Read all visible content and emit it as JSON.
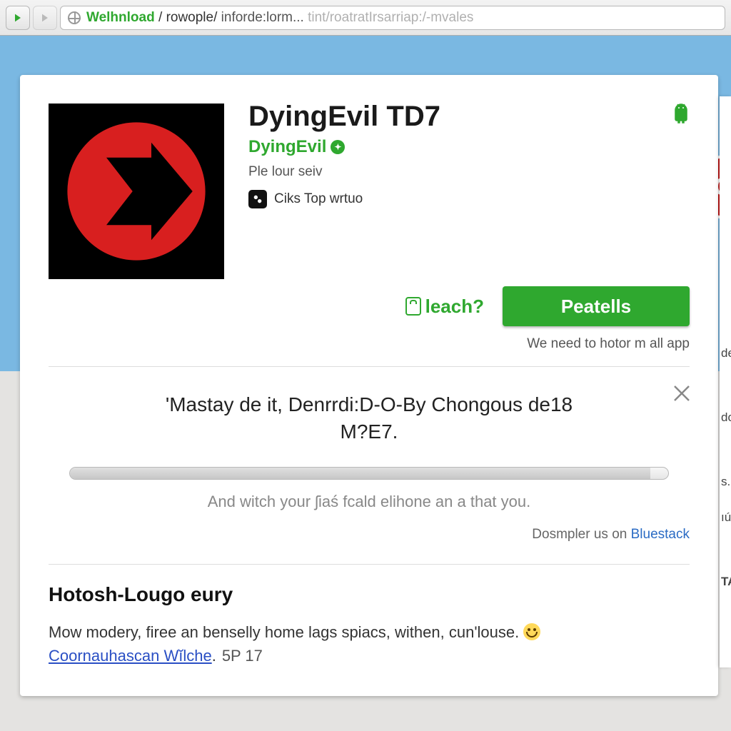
{
  "chrome": {
    "url_host": "Welhnload",
    "url_sep1": " / ",
    "url_path1": "rowople/",
    "url_path2": " inforde:lorm...",
    "url_tail": " tint/roatratIrsarriap:/-mvales"
  },
  "app": {
    "title": "DyingEvil TD7",
    "developer": "DyingEvil",
    "subtitle": "Ple lour seiv",
    "category_label": "Ciks Top wrtuo"
  },
  "action": {
    "leach_label": "leach?",
    "install_label": "Peatells",
    "sub_note": "We need to hotor m all app"
  },
  "promo": {
    "title_line1": "'Mastay de it, Denrrdi:D-O-By Chongous de18",
    "title_line2": "M?E7.",
    "subtitle": "And witch your ʃiaś fcald elihone an a that you.",
    "link_prefix": "Dosmpler us  on ",
    "link_text": "Bluestack"
  },
  "description": {
    "heading": "Hotosh-Lougo eury",
    "body": "Mow modery, firee an benselly home lags spiacs, withen, cun'louse. ",
    "link_text": "Coornauhascan Wĭlche",
    "trail": ".",
    "code": "5P 17"
  },
  "sidebar": {
    "items": [
      "de",
      "do",
      "s.it",
      "ıús",
      "TA"
    ]
  },
  "red_badge": "C"
}
